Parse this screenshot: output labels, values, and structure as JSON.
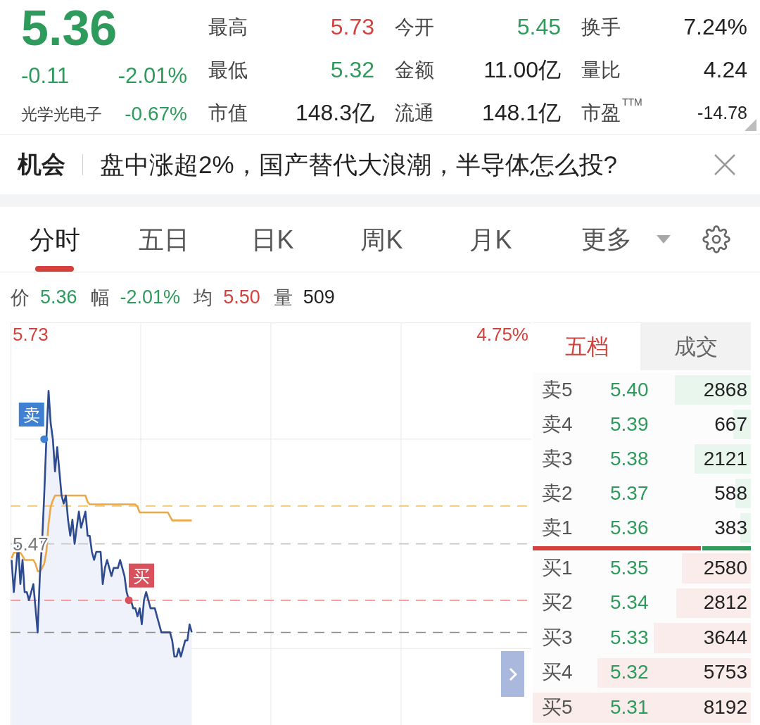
{
  "quote": {
    "price": "5.36",
    "change": "-0.11",
    "change_pct": "-2.01%",
    "color": "#2e9b5d"
  },
  "sector": {
    "name": "光学光电子",
    "change": "-0.67%",
    "color": "#2e9b5d"
  },
  "stats": [
    {
      "label": "最高",
      "value": "5.73",
      "color": "#d4403c"
    },
    {
      "label": "今开",
      "value": "5.45",
      "color": "#2e9b5d"
    },
    {
      "label": "换手",
      "value": "7.24%",
      "color": "#222222"
    },
    {
      "label": "最低",
      "value": "5.32",
      "color": "#2e9b5d"
    },
    {
      "label": "金额",
      "value": "11.00亿",
      "color": "#222222"
    },
    {
      "label": "量比",
      "value": "4.24",
      "color": "#222222"
    },
    {
      "label": "市值",
      "value": "148.3亿",
      "color": "#222222"
    },
    {
      "label": "流通",
      "value": "148.1亿",
      "color": "#222222"
    },
    {
      "label": "市盈$^{TTM}$",
      "value": "-14.78",
      "color": "#222222"
    }
  ],
  "banner": {
    "tag": "机会",
    "text": "盘中涨超2%，国产替代大浪潮，半导体怎么投?"
  },
  "tabs": [
    {
      "label": "分时",
      "selected": true
    },
    {
      "label": "五日",
      "selected": false
    },
    {
      "label": "日K",
      "selected": false
    },
    {
      "label": "周K",
      "selected": false
    },
    {
      "label": "月K",
      "selected": false
    }
  ],
  "more": {
    "label": "更多"
  },
  "readout": [
    {
      "label": "价",
      "value": "5.36",
      "color": "#2e9b5d"
    },
    {
      "label": "幅",
      "value": "-2.01%",
      "color": "#2e9b5d"
    },
    {
      "label": "均",
      "value": "5.50",
      "color": "#d4403c"
    },
    {
      "label": "量",
      "value": "509",
      "color": "#222222"
    }
  ],
  "chart": {
    "percent_label": "4.75%",
    "chart_data": {
      "type": "line",
      "ylim": [
        5.245,
        5.745
      ],
      "yticks": [
        {
          "value": 5.73,
          "label": "5.73"
        },
        {
          "value": 5.47,
          "label": "5.47"
        }
      ],
      "categories": [
        null,
        null,
        null,
        null,
        null,
        null,
        null,
        null,
        null,
        null,
        null,
        null,
        null,
        null,
        null,
        null,
        null,
        null,
        null,
        null,
        null,
        null,
        null,
        null,
        null,
        null,
        null,
        null,
        null,
        null,
        null,
        null,
        null,
        null,
        null,
        null,
        null,
        null,
        null,
        null,
        null,
        null,
        null,
        null,
        null,
        null,
        null,
        null,
        null,
        null,
        null,
        null,
        null,
        null,
        null,
        null,
        null,
        null,
        null,
        null,
        null,
        null,
        null,
        null,
        null,
        null,
        null,
        null,
        null,
        null,
        null,
        null,
        null,
        null,
        null,
        null,
        null,
        null,
        null,
        null,
        null,
        null,
        null,
        null,
        null,
        null,
        null,
        null,
        null,
        null,
        null,
        null,
        null,
        null,
        null,
        null,
        null,
        null,
        null,
        null,
        null,
        null,
        null,
        null,
        null,
        null,
        null,
        null,
        null,
        null,
        null,
        null,
        null,
        null,
        null,
        null,
        null,
        null,
        null,
        null,
        null,
        null,
        null,
        null,
        null,
        null,
        null,
        null,
        null,
        null,
        null,
        null,
        null,
        null,
        null,
        null,
        null,
        null,
        null,
        null,
        null,
        null,
        null,
        null,
        null,
        null,
        null,
        null,
        null,
        null,
        null,
        null,
        null,
        null,
        null,
        null,
        null,
        null,
        null,
        null,
        null,
        null,
        null,
        null,
        null,
        null,
        null,
        null,
        null,
        null,
        null,
        null,
        null,
        null,
        null,
        null,
        null,
        null,
        null,
        null,
        null,
        null,
        null,
        null,
        null,
        null,
        null,
        null,
        null,
        null,
        null,
        null,
        null,
        null,
        null,
        null,
        null,
        null,
        null,
        null,
        null,
        null,
        null,
        null,
        null,
        null,
        null,
        null,
        null,
        null,
        null,
        null,
        null,
        null,
        null,
        null,
        null,
        null,
        null,
        null,
        null,
        null,
        null,
        null,
        null,
        null,
        null,
        null,
        null,
        null,
        null,
        null,
        null,
        null,
        null,
        null,
        null,
        null,
        null,
        null
      ],
      "series": [
        {
          "color": "#2d4b8e",
          "values": [
            5.45,
            5.41,
            5.44,
            5.47,
            5.42,
            5.45,
            5.41,
            5.41,
            5.4,
            5.41,
            5.42,
            5.39,
            5.36,
            5.43,
            5.47,
            5.53,
            5.6,
            5.66,
            5.62,
            5.6,
            5.56,
            5.59,
            5.56,
            5.53,
            5.52,
            5.53,
            5.5,
            5.48,
            5.5,
            5.47,
            5.49,
            5.51,
            5.49,
            5.5,
            5.51,
            5.48,
            5.48,
            5.46,
            5.45,
            5.46,
            5.46,
            5.46,
            5.42,
            5.44,
            5.45,
            5.44,
            5.43,
            5.44,
            5.44,
            5.44,
            5.45,
            5.44,
            5.43,
            5.41,
            5.4,
            5.4,
            5.39,
            5.39,
            5.38,
            5.39,
            5.37,
            5.4,
            5.41,
            5.4,
            5.39,
            5.39,
            5.39,
            5.38,
            5.37,
            5.36,
            5.36,
            5.36,
            5.36,
            5.36,
            5.35,
            5.33,
            5.33,
            5.34,
            5.33,
            5.34,
            5.35,
            5.35,
            5.37,
            5.36,
            null,
            null,
            null,
            null,
            null,
            null,
            null,
            null,
            null,
            null,
            null,
            null,
            null,
            null,
            null,
            null,
            null,
            null,
            null,
            null,
            null,
            null,
            null,
            null,
            null,
            null,
            null,
            null,
            null,
            null,
            null,
            null,
            null,
            null,
            null,
            null,
            null,
            null,
            null,
            null,
            null,
            null,
            null,
            null,
            null,
            null,
            null,
            null,
            null,
            null,
            null,
            null,
            null,
            null,
            null,
            null,
            null,
            null,
            null,
            null,
            null,
            null,
            null,
            null,
            null,
            null,
            null,
            null,
            null,
            null,
            null,
            null,
            null,
            null,
            null,
            null,
            null,
            null,
            null,
            null,
            null,
            null,
            null,
            null,
            null,
            null,
            null,
            null,
            null,
            null,
            null,
            null,
            null,
            null,
            null,
            null,
            null,
            null,
            null,
            null,
            null,
            null,
            null,
            null,
            null,
            null,
            null,
            null,
            null,
            null,
            null,
            null,
            null,
            null,
            null,
            null,
            null,
            null,
            null,
            null,
            null,
            null,
            null,
            null,
            null,
            null,
            null,
            null,
            null,
            null,
            null,
            null,
            null,
            null,
            null,
            null,
            null,
            null,
            null,
            null,
            null,
            null,
            null,
            null,
            null,
            null,
            null,
            null,
            null,
            null,
            null,
            null,
            null,
            null,
            null,
            null
          ]
        },
        {
          "color": "#eba84a",
          "values": [
            5.452,
            5.459,
            5.459,
            5.459,
            5.459,
            5.455,
            5.45,
            5.45,
            5.45,
            5.45,
            5.45,
            5.445,
            5.436,
            5.436,
            5.44,
            5.445,
            5.46,
            5.495,
            5.516,
            5.524,
            5.53,
            5.53,
            5.53,
            5.53,
            5.53,
            5.53,
            5.53,
            5.53,
            5.53,
            5.53,
            5.53,
            5.53,
            5.53,
            5.53,
            5.53,
            5.522,
            5.519,
            5.519,
            5.519,
            5.519,
            5.519,
            5.519,
            5.519,
            5.519,
            5.519,
            5.519,
            5.519,
            5.519,
            5.519,
            5.519,
            5.519,
            5.519,
            5.519,
            5.519,
            5.519,
            5.519,
            5.519,
            5.519,
            5.516,
            5.509,
            5.509,
            5.509,
            5.509,
            5.509,
            5.509,
            5.509,
            5.509,
            5.509,
            5.509,
            5.509,
            5.509,
            5.509,
            5.509,
            5.504,
            5.499,
            5.499,
            5.499,
            5.499,
            5.499,
            5.499,
            5.499,
            5.499,
            5.499,
            5.499,
            null,
            null,
            null,
            null,
            null,
            null,
            null,
            null,
            null,
            null,
            null,
            null,
            null,
            null,
            null,
            null,
            null,
            null,
            null,
            null,
            null,
            null,
            null,
            null,
            null,
            null,
            null,
            null,
            null,
            null,
            null,
            null,
            null,
            null,
            null,
            null,
            null,
            null,
            null,
            null,
            null,
            null,
            null,
            null,
            null,
            null,
            null,
            null,
            null,
            null,
            null,
            null,
            null,
            null,
            null,
            null,
            null,
            null,
            null,
            null,
            null,
            null,
            null,
            null,
            null,
            null,
            null,
            null,
            null,
            null,
            null,
            null,
            null,
            null,
            null,
            null,
            null,
            null,
            null,
            null,
            null,
            null,
            null,
            null,
            null,
            null,
            null,
            null,
            null,
            null,
            null,
            null,
            null,
            null,
            null,
            null,
            null,
            null,
            null,
            null,
            null,
            null,
            null,
            null,
            null,
            null,
            null,
            null,
            null,
            null,
            null,
            null,
            null,
            null,
            null,
            null,
            null,
            null,
            null,
            null,
            null,
            null,
            null,
            null,
            null,
            null,
            null,
            null,
            null,
            null,
            null,
            null,
            null,
            null,
            null,
            null,
            null,
            null,
            null,
            null,
            null,
            null,
            null,
            null,
            null,
            null,
            null,
            null,
            null,
            null,
            null,
            null,
            null,
            null,
            null,
            null
          ]
        },
        {
          "name": "卖",
          "color": "#3f80d2",
          "marker": "circle",
          "values": [
            null,
            null,
            null,
            null,
            null,
            null,
            null,
            null,
            null,
            null,
            null,
            null,
            null,
            null,
            null,
            5.6,
            null,
            null,
            null,
            null,
            null,
            null,
            null,
            null,
            null,
            null,
            null,
            null,
            null,
            null,
            null,
            null,
            null,
            null,
            null,
            null,
            null,
            null,
            null,
            null,
            null,
            null,
            null,
            null,
            null,
            null,
            null,
            null,
            null,
            null,
            null,
            null,
            null,
            null,
            null,
            null,
            null,
            null,
            null,
            null,
            null,
            null,
            null,
            null,
            null,
            null,
            null,
            null,
            null,
            null,
            null,
            null,
            null,
            null,
            null,
            null,
            null,
            null,
            null,
            null,
            null,
            null,
            null,
            null,
            null,
            null,
            null,
            null,
            null,
            null,
            null,
            null,
            null,
            null,
            null,
            null,
            null,
            null,
            null,
            null,
            null,
            null,
            null,
            null,
            null,
            null,
            null,
            null,
            null,
            null,
            null,
            null,
            null,
            null,
            null,
            null,
            null,
            null,
            null,
            null,
            null,
            null,
            null,
            null,
            null,
            null,
            null,
            null,
            null,
            null,
            null,
            null,
            null,
            null,
            null,
            null,
            null,
            null,
            null,
            null,
            null,
            null,
            null,
            null,
            null,
            null,
            null,
            null,
            null,
            null,
            null,
            null,
            null,
            null,
            null,
            null,
            null,
            null,
            null,
            null,
            null,
            null,
            null,
            null,
            null,
            null,
            null,
            null,
            null,
            null,
            null,
            null,
            null,
            null,
            null,
            null,
            null,
            null,
            null,
            null,
            null,
            null,
            null,
            null,
            null,
            null,
            null,
            null,
            null,
            null,
            null,
            null,
            null,
            null,
            null,
            null,
            null,
            null,
            null,
            null,
            null,
            null,
            null,
            null,
            null,
            null,
            null,
            null,
            null,
            null,
            null,
            null,
            null,
            null,
            null,
            null,
            null,
            null,
            null,
            null,
            null,
            null,
            null,
            null,
            null,
            null,
            null,
            null,
            null,
            null,
            null,
            null,
            null,
            null,
            null,
            null,
            null,
            null,
            null,
            null
          ]
        },
        {
          "name": "买",
          "color": "#d9515c",
          "marker": "circle",
          "values": [
            null,
            null,
            null,
            null,
            null,
            null,
            null,
            null,
            null,
            null,
            null,
            null,
            null,
            null,
            null,
            null,
            null,
            null,
            null,
            null,
            null,
            null,
            null,
            null,
            null,
            null,
            null,
            null,
            null,
            null,
            null,
            null,
            null,
            null,
            null,
            null,
            null,
            null,
            null,
            null,
            null,
            null,
            null,
            null,
            null,
            null,
            null,
            null,
            null,
            null,
            null,
            null,
            null,
            null,
            5.4,
            null,
            null,
            null,
            null,
            null,
            null,
            null,
            null,
            null,
            null,
            null,
            null,
            null,
            null,
            null,
            null,
            null,
            null,
            null,
            null,
            null,
            null,
            null,
            null,
            null,
            null,
            null,
            null,
            null,
            null,
            null,
            null,
            null,
            null,
            null,
            null,
            null,
            null,
            null,
            null,
            null,
            null,
            null,
            null,
            null,
            null,
            null,
            null,
            null,
            null,
            null,
            null,
            null,
            null,
            null,
            null,
            null,
            null,
            null,
            null,
            null,
            null,
            null,
            null,
            null,
            null,
            null,
            null,
            null,
            null,
            null,
            null,
            null,
            null,
            null,
            null,
            null,
            null,
            null,
            null,
            null,
            null,
            null,
            null,
            null,
            null,
            null,
            null,
            null,
            null,
            null,
            null,
            null,
            null,
            null,
            null,
            null,
            null,
            null,
            null,
            null,
            null,
            null,
            null,
            null,
            null,
            null,
            null,
            null,
            null,
            null,
            null,
            null,
            null,
            null,
            null,
            null,
            null,
            null,
            null,
            null,
            null,
            null,
            null,
            null,
            null,
            null,
            null,
            null,
            null,
            null,
            null,
            null,
            null,
            null,
            null,
            null,
            null,
            null,
            null,
            null,
            null,
            null,
            null,
            null,
            null,
            null,
            null,
            null,
            null,
            null,
            null,
            null,
            null,
            null,
            null,
            null,
            null,
            null,
            null,
            null,
            null,
            null,
            null,
            null,
            null,
            null,
            null,
            null,
            null,
            null,
            null,
            null,
            null,
            null,
            null,
            null,
            null,
            null,
            null,
            null,
            null,
            null,
            null,
            null
          ]
        }
      ],
      "ref_lines": [
        {
          "axis": "y",
          "value": 5.517,
          "color": "#f0c674"
        },
        {
          "axis": "y",
          "value": 5.47,
          "color": "#c8c8c8"
        },
        {
          "axis": "y",
          "value": 5.4,
          "color": "#e38080"
        },
        {
          "axis": "y",
          "value": 5.36,
          "color": "#8c8c8c"
        }
      ]
    }
  },
  "order_book": {
    "tabs": [
      {
        "label": "五档",
        "selected": true
      },
      {
        "label": "成交",
        "selected": false
      }
    ],
    "asks": [
      {
        "label": "卖5",
        "price": "5.40",
        "volume": "2868",
        "level": 0.35
      },
      {
        "label": "卖4",
        "price": "5.39",
        "volume": "667",
        "level": 0.081
      },
      {
        "label": "卖3",
        "price": "5.38",
        "volume": "2121",
        "level": 0.259
      },
      {
        "label": "卖2",
        "price": "5.37",
        "volume": "588",
        "level": 0.072
      },
      {
        "label": "卖1",
        "price": "5.36",
        "volume": "383",
        "level": 0.047
      }
    ],
    "ratio": {
      "level": 0.776
    },
    "bids": [
      {
        "label": "买1",
        "price": "5.35",
        "volume": "2580",
        "level": 0.315
      },
      {
        "label": "买2",
        "price": "5.34",
        "volume": "2812",
        "level": 0.343
      },
      {
        "label": "买3",
        "price": "5.33",
        "volume": "3644",
        "level": 0.445
      },
      {
        "label": "买4",
        "price": "5.32",
        "volume": "5753",
        "level": 0.702
      },
      {
        "label": "买5",
        "price": "5.31",
        "volume": "8192",
        "level": 1.0
      }
    ]
  }
}
